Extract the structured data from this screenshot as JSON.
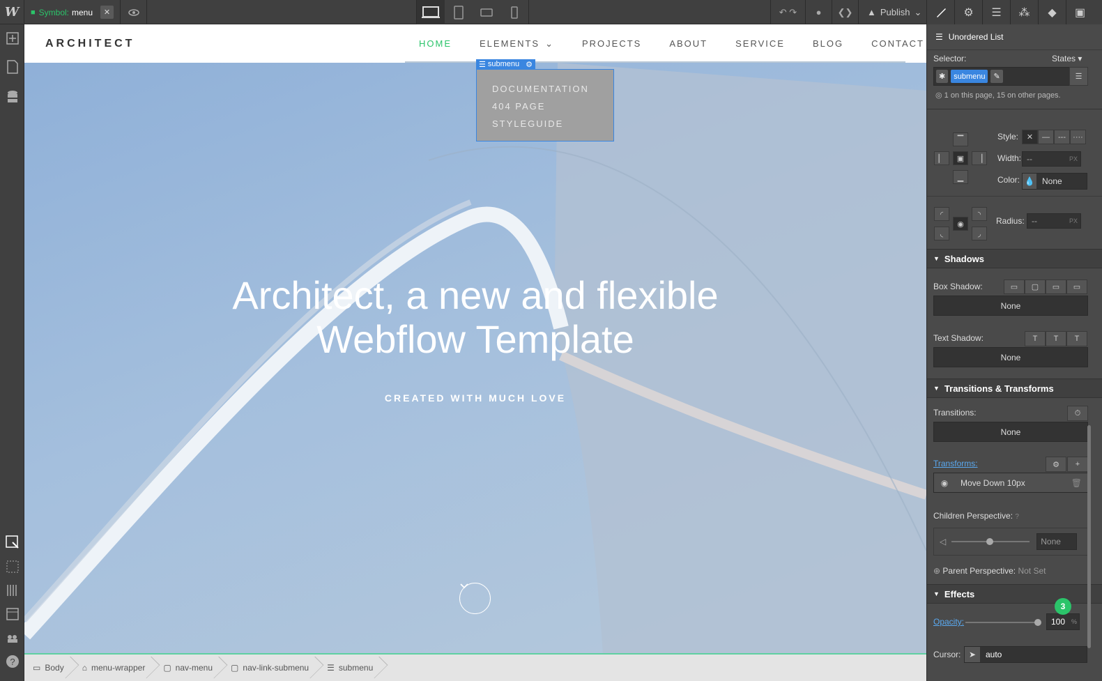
{
  "topbar": {
    "logo": "W",
    "symbol_label": "Symbol:",
    "symbol_name": "menu",
    "close": "✕",
    "publish": "Publish"
  },
  "site": {
    "brand": "ARCHITECT",
    "nav": [
      {
        "label": "HOME",
        "active": true
      },
      {
        "label": "ELEMENTS",
        "active": false
      },
      {
        "label": "PROJECTS",
        "active": false
      },
      {
        "label": "ABOUT",
        "active": false
      },
      {
        "label": "SERVICE",
        "active": false
      },
      {
        "label": "BLOG",
        "active": false
      },
      {
        "label": "CONTACT",
        "active": false
      }
    ],
    "submenu_tag": "submenu",
    "submenu_items": [
      "DOCUMENTATION",
      "404 PAGE",
      "STYLEGUIDE"
    ],
    "hero_title_line1": "Architect, a new and flexible",
    "hero_title_line2": "Webflow Template",
    "hero_sub": "CREATED WITH MUCH LOVE"
  },
  "breadcrumb": [
    "Body",
    "menu-wrapper",
    "nav-menu",
    "nav-link-submenu",
    "submenu"
  ],
  "panel": {
    "element_type": "Unordered List",
    "selector_label": "Selector:",
    "states_label": "States",
    "selector_chip": "submenu",
    "usage_note": "1 on this page, 15 on other pages.",
    "border": {
      "style_label": "Style:",
      "width_label": "Width:",
      "width_value": "--",
      "width_unit": "PX",
      "color_label": "Color:",
      "color_value": "None",
      "radius_label": "Radius:",
      "radius_value": "--",
      "radius_unit": "PX"
    },
    "shadows": {
      "title": "Shadows",
      "box_label": "Box Shadow:",
      "box_value": "None",
      "text_label": "Text Shadow:",
      "text_value": "None"
    },
    "transitions": {
      "title": "Transitions & Transforms",
      "transitions_label": "Transitions:",
      "transitions_value": "None",
      "transforms_label": "Transforms:",
      "transform_item": "Move Down 10px",
      "children_label": "Children Perspective:",
      "children_value": "None",
      "parent_label": "Parent Perspective:",
      "parent_value": "Not Set"
    },
    "effects": {
      "title": "Effects",
      "opacity_label": "Opacity:",
      "opacity_value": "100",
      "opacity_unit": "%",
      "opacity_level": 1.0,
      "cursor_label": "Cursor:",
      "cursor_value": "auto",
      "badge": "3"
    }
  },
  "colors": {
    "accent_green": "#2bc46a",
    "selection_blue": "#3a86e0",
    "panel_bg": "#4a4a4a"
  }
}
